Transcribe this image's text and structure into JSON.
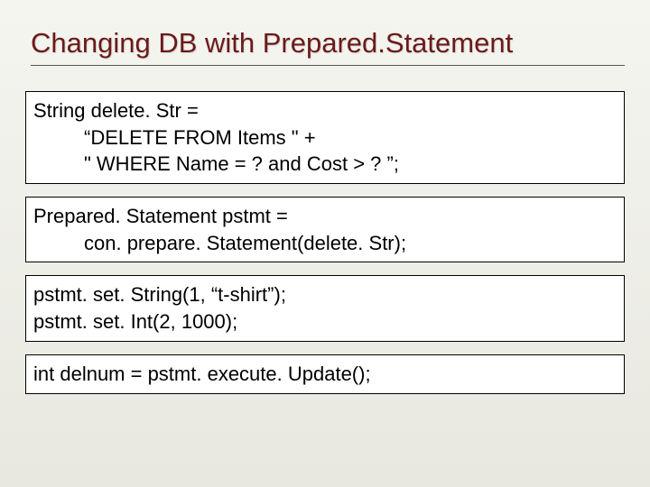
{
  "title": "Changing DB with Prepared.Statement",
  "code": {
    "box1": {
      "l1": "String delete. Str =",
      "l2": "“DELETE FROM Items \" +",
      "l3": "\" WHERE Name = ? and Cost > ? ”;"
    },
    "box2": {
      "l1": "Prepared. Statement pstmt =",
      "l2": "con. prepare. Statement(delete. Str);"
    },
    "box3": {
      "l1": "pstmt. set. String(1, “t-shirt”);",
      "l2": "pstmt. set. Int(2, 1000);"
    },
    "box4": {
      "l1": "int delnum = pstmt. execute. Update();"
    }
  }
}
